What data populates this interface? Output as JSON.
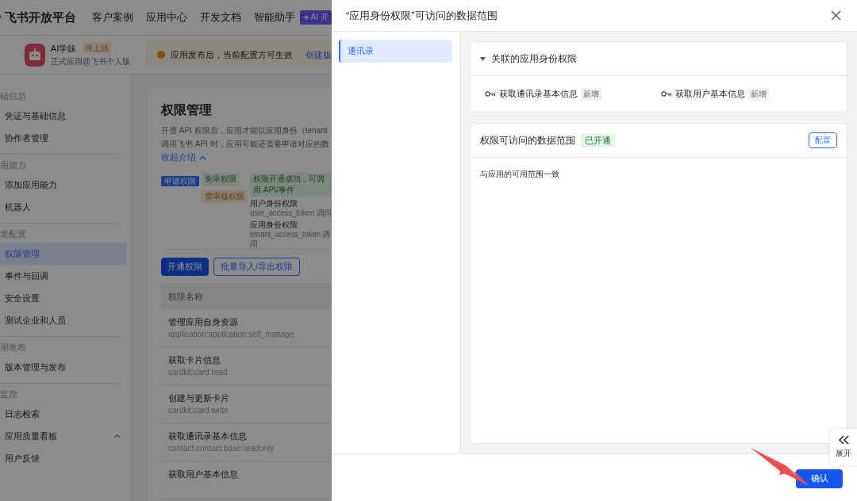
{
  "top_nav": {
    "brand": "飞书开放平台",
    "items": [
      "客户案例",
      "应用中心",
      "开发文档",
      "智能助手"
    ],
    "ai_badge": "AI 开"
  },
  "app": {
    "name": "AI学妹",
    "status": "待上线",
    "subtitle": "正式应用@飞书个人版"
  },
  "notice": {
    "text": "应用发布后，当前配置方可生效",
    "link": "创建版"
  },
  "sidebar": {
    "groups": [
      {
        "label": "础信息",
        "items": [
          {
            "label": "凭证与基础信息",
            "selected": false
          },
          {
            "label": "协作者管理",
            "selected": false
          }
        ]
      },
      {
        "label": "用能力",
        "items": [
          {
            "label": "添加应用能力",
            "selected": false
          },
          {
            "label": "机器人",
            "selected": false
          }
        ]
      },
      {
        "label": "发配置",
        "items": [
          {
            "label": "权限管理",
            "selected": true
          },
          {
            "label": "事件与回调",
            "selected": false
          },
          {
            "label": "安全设置",
            "selected": false
          },
          {
            "label": "测试企业和人员",
            "selected": false
          }
        ]
      },
      {
        "label": "用发布",
        "items": [
          {
            "label": "版本管理与发布",
            "selected": false
          }
        ]
      },
      {
        "label": "监控",
        "items": [
          {
            "label": "日志检索",
            "selected": false
          },
          {
            "label": "应用质量看板",
            "selected": false,
            "expanded": true
          },
          {
            "label": "用户反馈",
            "selected": false
          }
        ]
      }
    ]
  },
  "main": {
    "title": "权限管理",
    "desc_lines": [
      "开通 API 权限后，应用才能以应用身份（tenant",
      "调用飞书 API 时，应用可能还需要申请对应的数"
    ],
    "collapse_link": "收起介绍",
    "diagram": {
      "apply": "申请权限",
      "free": "免审权限",
      "success": "权限开通成功，可调用 API/事件",
      "review": "需审核权限",
      "user": "用户身份权限",
      "user_token": "user_access_token 调用",
      "app": "应用身份权限",
      "app_token": "tenant_access_token 调用"
    },
    "buttons": [
      {
        "label": "开通权限",
        "kind": "primary"
      },
      {
        "label": "批量导入/导出权限",
        "kind": "outline"
      }
    ],
    "table": {
      "columns": [
        "权限名称"
      ],
      "rows": [
        {
          "name": "管理应用自身资源",
          "code": "application:application:self_manage"
        },
        {
          "name": "获取卡片信息",
          "code": "cardkit:card:read"
        },
        {
          "name": "创建与更新卡片",
          "code": "cardkit:card:write"
        },
        {
          "name": "获取通讯录基本信息",
          "code": "contact:contact.base:readonly"
        },
        {
          "name": "获取用户基本信息"
        }
      ]
    }
  },
  "drawer": {
    "title": "“应用身份权限”可访问的数据范围",
    "nav": [
      {
        "label": "通讯录",
        "selected": true
      }
    ],
    "related": {
      "title": "关联的应用身份权限",
      "expanded": true,
      "items": [
        {
          "label": "获取通讯录基本信息",
          "tag": "新增"
        },
        {
          "label": "获取用户基本信息",
          "tag": "新增"
        }
      ]
    },
    "scope": {
      "title": "权限可访问的数据范围",
      "status": "已开通",
      "button": "配置",
      "text": "与应用的可用范围一致"
    },
    "expand_tab": "展开",
    "confirm": "确认"
  }
}
